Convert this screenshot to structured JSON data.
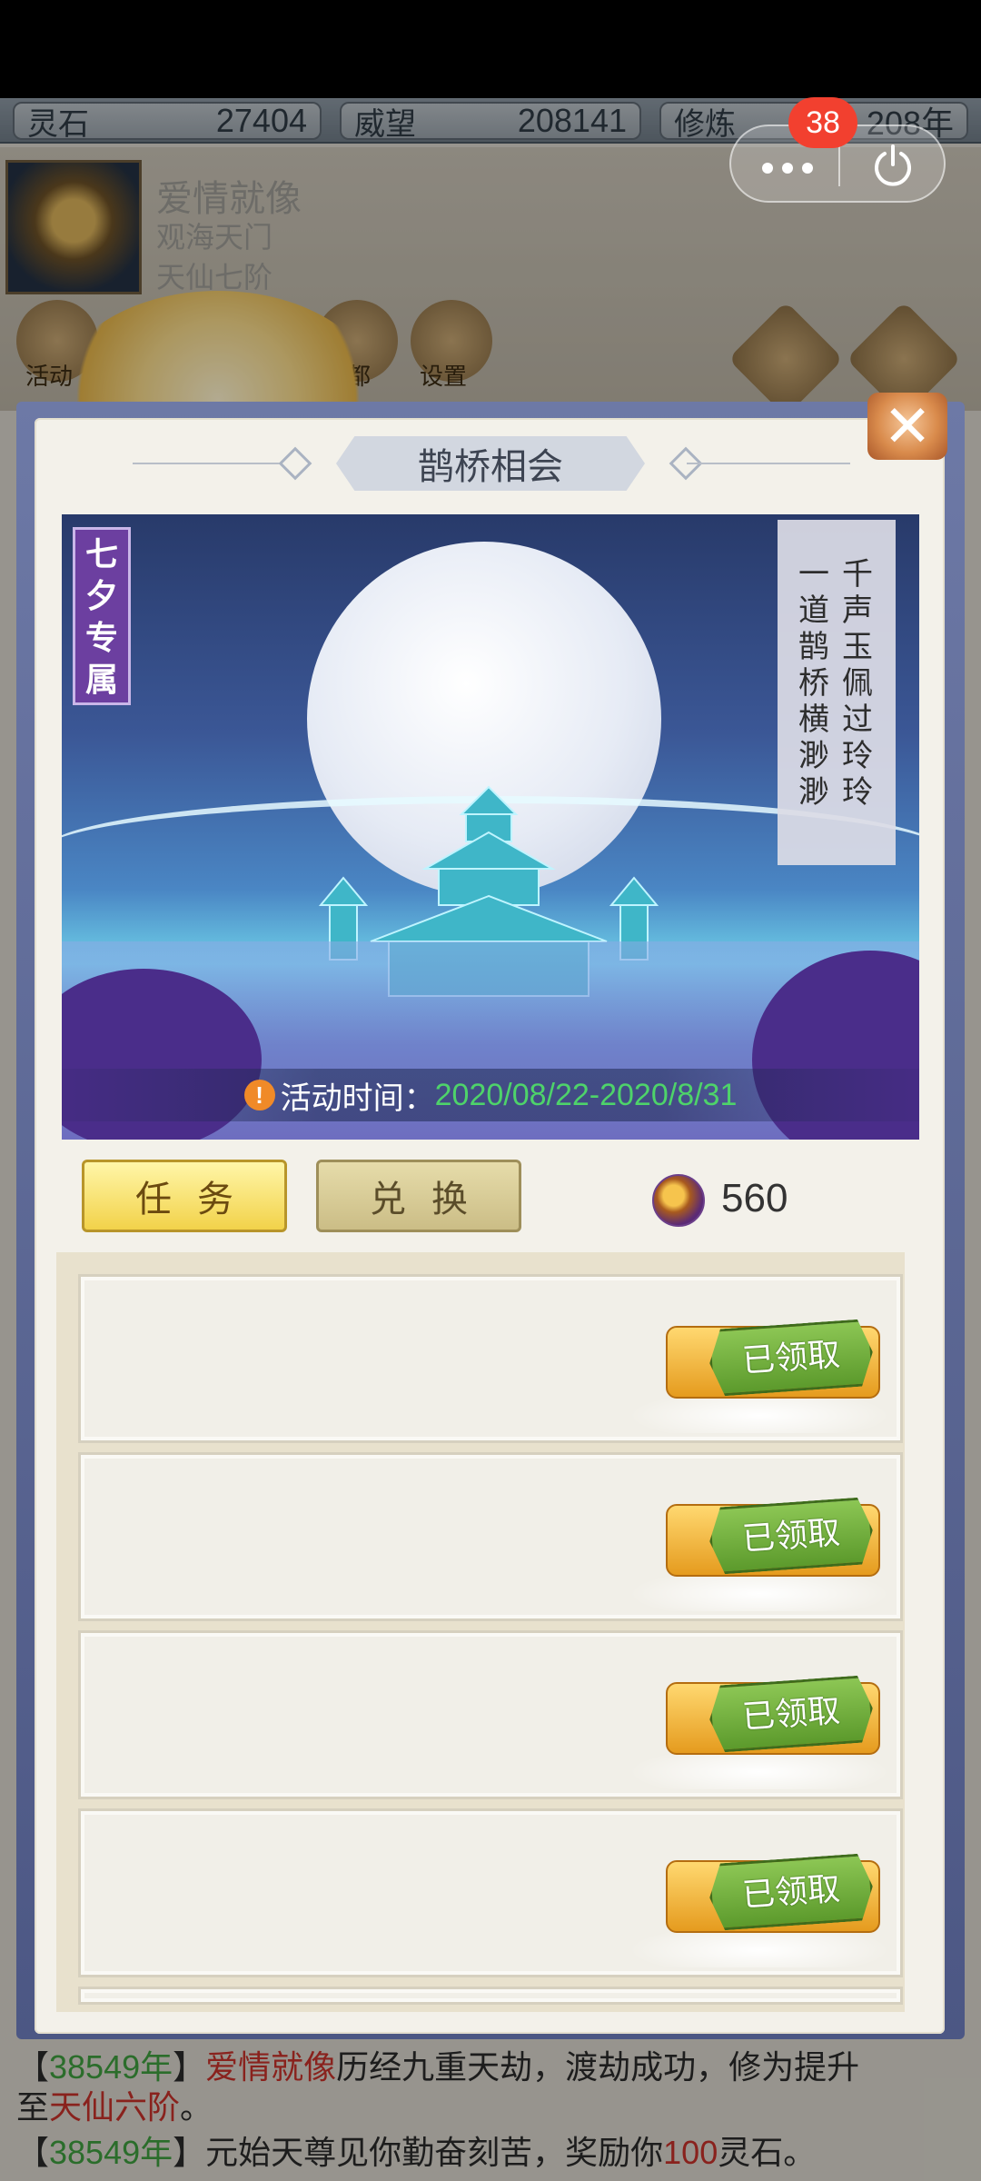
{
  "resources": [
    {
      "label": "灵石",
      "value": "27404"
    },
    {
      "label": "威望",
      "value": "208141"
    },
    {
      "label": "修炼",
      "value": "208年"
    }
  ],
  "notification_badge": "38",
  "player": {
    "name": "爱情就像",
    "sect": "观海天门",
    "rank": "天仙七阶"
  },
  "top_icons": [
    "活动",
    "仙都",
    "设置"
  ],
  "modal": {
    "title": "鹊桥相会",
    "close_glyph": "✕",
    "banner": {
      "exclusive_tag": "七夕专属",
      "poem_line_1": "千声玉佩过玲玲",
      "poem_line_2": "一道鹊桥横渺渺",
      "time_label": "活动时间：",
      "time_value": "2020/08/22-2020/8/31"
    },
    "tabs": [
      {
        "label": "任务",
        "active": true
      },
      {
        "label": "兑换",
        "active": false
      }
    ],
    "currency": {
      "icon": "magpie-coin-icon",
      "value": "560"
    },
    "tasks": [
      {
        "status": "已领取"
      },
      {
        "status": "已领取"
      },
      {
        "status": "已领取"
      },
      {
        "status": "已领取"
      }
    ]
  },
  "log": [
    {
      "year": "38549年",
      "text_a": "",
      "name": "爱情就像",
      "text_b": "历经九重天劫，渡劫成功，修为提升"
    },
    {
      "line2_pre": "至",
      "rank": "天仙六阶",
      "line2_post": "。"
    },
    {
      "year": "38549年",
      "text_a": "元始天尊见你勤奋刻苦，奖励你",
      "amount": "100",
      "text_b": "灵石。"
    }
  ],
  "colors": {
    "modal_frame": "#5a6592",
    "active_tab": "#f2d24a",
    "claimed_stamp": "#6aa83a",
    "time_value": "#4ed36a"
  }
}
